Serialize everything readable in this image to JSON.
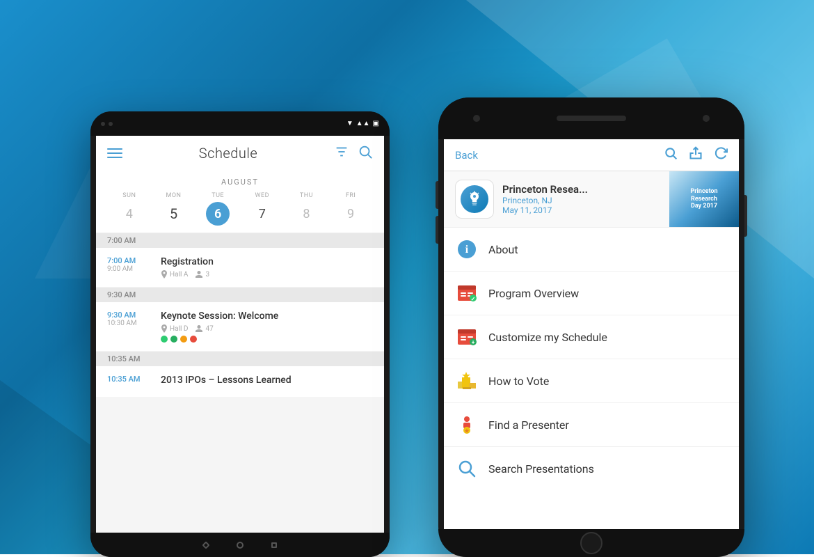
{
  "background": {
    "color1": "#1a8fcc",
    "color2": "#0e6fa3"
  },
  "android_screen": {
    "title": "Schedule",
    "calendar": {
      "month": "AUGUST",
      "days": [
        {
          "name": "SUN",
          "num": "4",
          "style": "light"
        },
        {
          "name": "MON",
          "num": "5",
          "style": "dark"
        },
        {
          "name": "TUE",
          "num": "6",
          "style": "today"
        },
        {
          "name": "WED",
          "num": "7",
          "style": "dark"
        },
        {
          "name": "THU",
          "num": "8",
          "style": "light"
        },
        {
          "name": "FRI",
          "num": "9",
          "style": "light"
        }
      ]
    },
    "time_sections": [
      {
        "time": "7:00 AM",
        "items": [
          {
            "start": "7:00 AM",
            "end": "9:00 AM",
            "name": "Registration",
            "location": "Hall A",
            "attendees": "3"
          }
        ]
      },
      {
        "time": "9:30 AM",
        "items": [
          {
            "start": "9:30 AM",
            "end": "10:30 AM",
            "name": "Keynote Session: Welcome",
            "location": "Hall D",
            "attendees": "47",
            "dots": [
              "#e74c3c",
              "#2ecc71",
              "#f39c12",
              "#e74c3c"
            ]
          }
        ]
      },
      {
        "time": "10:35 AM",
        "items": [
          {
            "start": "10:35 AM",
            "end": "",
            "name": "2013 IPOs - Lessons Learned",
            "location": "",
            "attendees": ""
          }
        ]
      }
    ]
  },
  "iphone_screen": {
    "nav": {
      "back_label": "Back",
      "search_label": "search",
      "share_label": "share",
      "refresh_label": "refresh"
    },
    "event": {
      "name": "Princeton Resea...",
      "location": "Princeton, NJ",
      "date": "May 11, 2017",
      "bg_text": "Princeton\nResearch\nDay 2017"
    },
    "menu_items": [
      {
        "id": "about",
        "icon": "ℹ️",
        "icon_color": "#4a9fd4",
        "label": "About"
      },
      {
        "id": "program-overview",
        "icon": "📅",
        "icon_color": "#e74c3c",
        "label": "Program Overview"
      },
      {
        "id": "customize-schedule",
        "icon": "📅",
        "icon_color": "#e74c3c",
        "label": "Customize my Schedule"
      },
      {
        "id": "how-to-vote",
        "icon": "🏆",
        "icon_color": "#f39c12",
        "label": "How to Vote"
      },
      {
        "id": "find-presenter",
        "icon": "👤",
        "icon_color": "#e74c3c",
        "label": "Find a Presenter"
      },
      {
        "id": "search-presentations",
        "icon": "🔍",
        "icon_color": "#4a9fd4",
        "label": "Search Presentations"
      }
    ]
  }
}
